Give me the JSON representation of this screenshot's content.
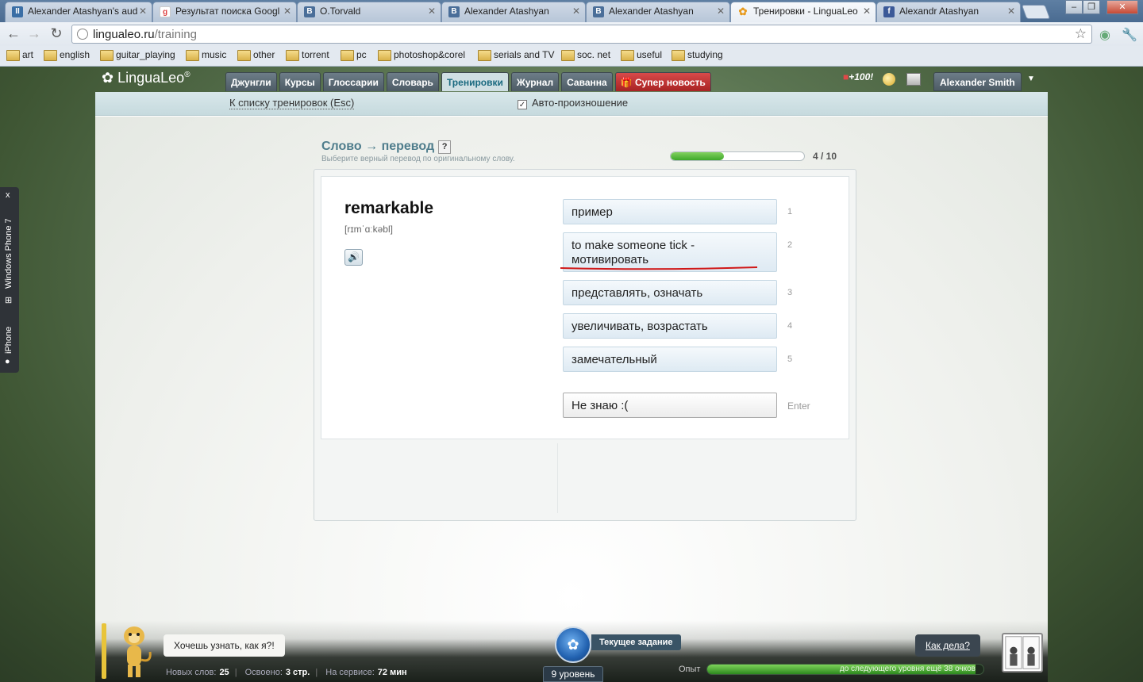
{
  "browser": {
    "tabs": [
      {
        "title": "Alexander Atashyan's aud",
        "fav": "II",
        "fav_color": "#3a6ea5",
        "active": false
      },
      {
        "title": "Результат поиска Googl",
        "fav": "g",
        "fav_color": "#d44",
        "active": false
      },
      {
        "title": "O.Torvald",
        "fav": "vk",
        "fav_color": "#4a6e99",
        "active": false
      },
      {
        "title": "Alexander Atashyan",
        "fav": "vk",
        "fav_color": "#4a6e99",
        "active": false
      },
      {
        "title": "Alexander Atashyan",
        "fav": "vk",
        "fav_color": "#4a6e99",
        "active": false
      },
      {
        "title": "Тренировки - LinguaLeo",
        "fav": "✿",
        "fav_color": "#e89a1c",
        "active": true
      },
      {
        "title": "Alexandr Atashyan",
        "fav": "f",
        "fav_color": "#3b5998",
        "active": false
      }
    ],
    "url_host": "lingualeo.ru",
    "url_path": "/training",
    "bookmarks": [
      "art",
      "english",
      "guitar_playing",
      "music",
      "other",
      "torrent",
      "pc",
      "photoshop&corel",
      "serials and TV",
      "soc. net",
      "useful",
      "studying"
    ]
  },
  "header": {
    "logo": "LinguaLeo",
    "logo_mark": "®",
    "nav": [
      "Джунгли",
      "Курсы",
      "Глоссарии",
      "Словарь",
      "Тренировки",
      "Журнал",
      "Саванна",
      "Супер новость"
    ],
    "active_nav": "Тренировки",
    "badge": "+100!",
    "user": "Alexander Smith"
  },
  "subbar": {
    "back": "К списку тренировок (Esc)",
    "auto_pron": "Авто-произношение",
    "auto_pron_checked": true
  },
  "training": {
    "title": "Слово → перевод",
    "help": "?",
    "subtitle": "Выберите верный перевод по оригинальному слову.",
    "progress_current": 4,
    "progress_total": 10,
    "progress_text": "4 / 10",
    "word": "remarkable",
    "transcription": "[rɪmˈɑːkəbl]",
    "options": [
      {
        "text": "пример",
        "num": "1"
      },
      {
        "text": "to make someone tick - мотивировать",
        "num": "2"
      },
      {
        "text": "представлять, означать",
        "num": "3"
      },
      {
        "text": "увеличивать, возрастать",
        "num": "4"
      },
      {
        "text": "замечательный",
        "num": "5"
      }
    ],
    "dont_know": "Не знаю :(",
    "enter_hint": "Enter"
  },
  "phone_tab": {
    "close": "x",
    "windows_phone": "Windows Phone 7",
    "iphone": "iPhone"
  },
  "footer": {
    "bubble": "Хочешь узнать, как я?!",
    "new_words_label": "Новых слов:",
    "new_words": "25",
    "learned_label": "Освоено:",
    "learned": "3 стр.",
    "service_label": "На сервисе:",
    "service": "72 мин",
    "task_label": "Текущее задание",
    "level": "9 уровень",
    "exp_label": "Опыт",
    "exp_text": "до следующего уровня ещё 38 очков",
    "how_are": "Как дела?"
  }
}
